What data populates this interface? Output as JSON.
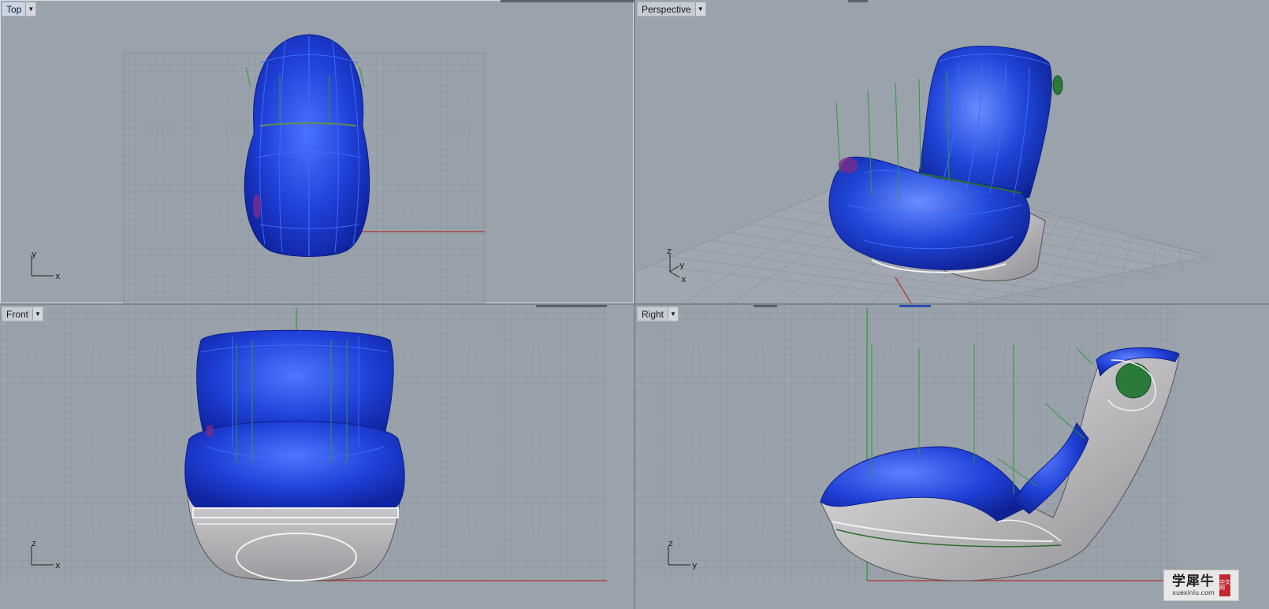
{
  "viewports": {
    "top": {
      "title": "Top",
      "axis_labels": {
        "vertical": "y",
        "horizontal": "x"
      }
    },
    "perspective": {
      "title": "Perspective",
      "axis_labels": {
        "vertical": "z",
        "horizontal": "y",
        "third": "x"
      }
    },
    "front": {
      "title": "Front",
      "axis_labels": {
        "vertical": "z",
        "horizontal": "x"
      }
    },
    "right": {
      "title": "Right",
      "axis_labels": {
        "vertical": "z",
        "horizontal": "y"
      }
    }
  },
  "active_viewport": "Top",
  "dropdown_glyph": "▼",
  "watermark": {
    "chinese": "学犀牛",
    "url": "xuexiniu.com",
    "seal": "中文网"
  },
  "colors": {
    "background": "#9aa2ac",
    "grid": "#8a929b",
    "surface_blue": "#1e3fd0",
    "isocurve": "#3b6bff",
    "green_axis": "#2e9a3a",
    "red_axis": "#b33434",
    "grey_shell": "#c9c9cc"
  }
}
